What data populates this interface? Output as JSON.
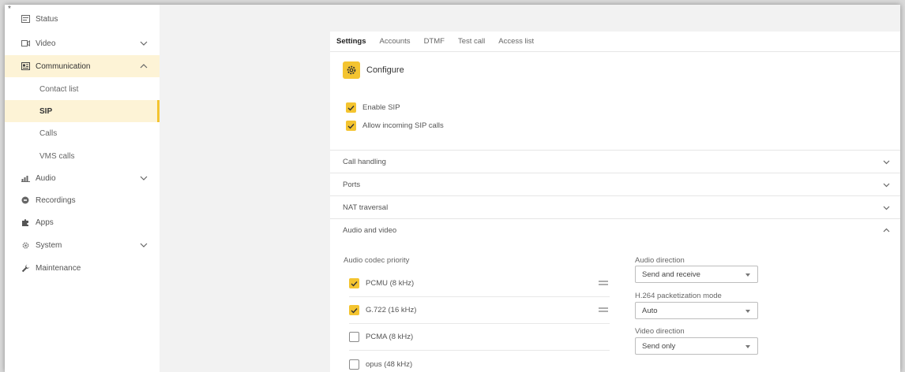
{
  "sidebar": {
    "items": [
      {
        "label": "Status"
      },
      {
        "label": "Video"
      },
      {
        "label": "Communication"
      },
      {
        "label": "Contact list"
      },
      {
        "label": "SIP"
      },
      {
        "label": "Calls"
      },
      {
        "label": "VMS calls"
      },
      {
        "label": "Audio"
      },
      {
        "label": "Recordings"
      },
      {
        "label": "Apps"
      },
      {
        "label": "System"
      },
      {
        "label": "Maintenance"
      }
    ]
  },
  "tabs": [
    {
      "label": "Settings",
      "active": true
    },
    {
      "label": "Accounts"
    },
    {
      "label": "DTMF"
    },
    {
      "label": "Test call"
    },
    {
      "label": "Access list"
    }
  ],
  "configure": {
    "label": "Configure"
  },
  "options": {
    "enable_sip": "Enable SIP",
    "allow_incoming": "Allow incoming SIP calls"
  },
  "sections": {
    "call_handling": "Call handling",
    "ports": "Ports",
    "nat_traversal": "NAT traversal",
    "audio_and_video": "Audio and video"
  },
  "audio_video": {
    "codec_priority_label": "Audio codec priority",
    "codecs": [
      {
        "label": "PCMU (8 kHz)",
        "checked": true
      },
      {
        "label": "G.722 (16 kHz)",
        "checked": true
      },
      {
        "label": "PCMA (8 kHz)",
        "checked": false
      },
      {
        "label": "opus (48 kHz)",
        "checked": false
      }
    ],
    "audio_direction_label": "Audio direction",
    "audio_direction_value": "Send and receive",
    "h264_label": "H.264 packetization mode",
    "h264_value": "Auto",
    "video_direction_label": "Video direction",
    "video_direction_value": "Send only"
  },
  "colors": {
    "accent": "#f4c430",
    "active_bg": "#fdf3d6"
  }
}
